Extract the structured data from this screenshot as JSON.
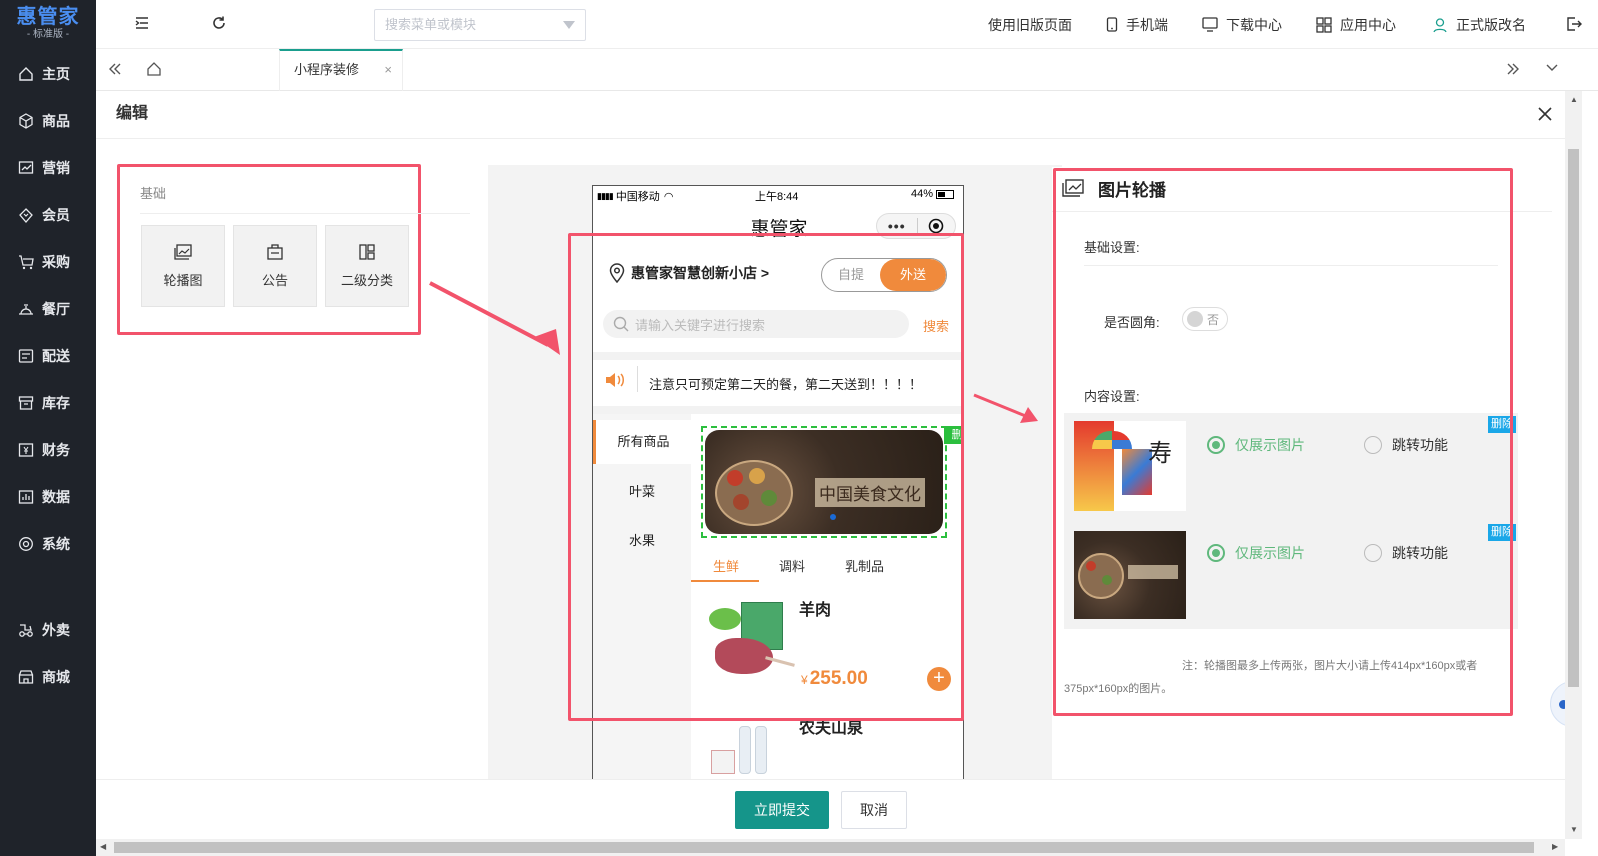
{
  "brand": {
    "name": "惠管家",
    "edition": "- 标准版 -"
  },
  "sidebar": {
    "items": [
      {
        "label": "主页",
        "icon": "home-icon"
      },
      {
        "label": "商品",
        "icon": "box-icon"
      },
      {
        "label": "营销",
        "icon": "chart-icon"
      },
      {
        "label": "会员",
        "icon": "diamond-icon"
      },
      {
        "label": "采购",
        "icon": "cart-icon"
      },
      {
        "label": "餐厅",
        "icon": "restaurant-icon"
      },
      {
        "label": "配送",
        "icon": "delivery-icon"
      },
      {
        "label": "库存",
        "icon": "archive-icon"
      },
      {
        "label": "财务",
        "icon": "finance-icon"
      },
      {
        "label": "数据",
        "icon": "data-icon"
      },
      {
        "label": "系统",
        "icon": "settings-icon"
      },
      {
        "label": "外卖",
        "icon": "takeout-icon"
      },
      {
        "label": "商城",
        "icon": "store-icon"
      }
    ]
  },
  "topbar": {
    "search_placeholder": "搜索菜单或模块",
    "links": [
      "使用旧版页面",
      "手机端",
      "下载中心",
      "应用中心",
      "正式版改名"
    ]
  },
  "tabs": {
    "active": "小程序装修"
  },
  "dialog": {
    "title": "编辑"
  },
  "components": {
    "section": "基础",
    "items": [
      {
        "label": "轮播图",
        "icon": "image-icon"
      },
      {
        "label": "公告",
        "icon": "notice-icon"
      },
      {
        "label": "二级分类",
        "icon": "grid-icon"
      }
    ]
  },
  "phone": {
    "carrier": "中国移动",
    "time": "上午8:44",
    "battery": "44%",
    "app_title": "惠管家",
    "store": "惠管家智慧创新小店 >",
    "mode_pickup": "自提",
    "mode_delivery": "外送",
    "search_placeholder": "请输入关键字进行搜索",
    "search_btn": "搜索",
    "notice": "注意只可预定第二天的餐，第二天送到！！！！",
    "categories": [
      "所有商品",
      "叶菜",
      "水果"
    ],
    "delete_label": "删 除",
    "banner_text": "中国美食文化",
    "subtabs": [
      "生鲜",
      "调料",
      "乳制品"
    ],
    "products": [
      {
        "name": "羊肉",
        "currency": "¥",
        "price": "255.00"
      },
      {
        "name": "农夫山泉"
      }
    ]
  },
  "settings": {
    "title": "图片轮播",
    "basic": "基础设置:",
    "rounded_label": "是否圆角:",
    "rounded_value": "否",
    "content": "内容设置:",
    "items": [
      {
        "opt1": "仅展示图片",
        "opt2": "跳转功能",
        "del": "删除"
      },
      {
        "opt1": "仅展示图片",
        "opt2": "跳转功能",
        "del": "删除"
      }
    ],
    "note": "注：轮播图最多上传两张，图片大小请上传414px*160px或者375px*160px的图片。"
  },
  "footer": {
    "submit": "立即提交",
    "cancel": "取消"
  },
  "colors": {
    "accent": "#15958a",
    "orange": "#f08a3c",
    "highlight": "#f2536b",
    "green": "#5fb87c"
  }
}
